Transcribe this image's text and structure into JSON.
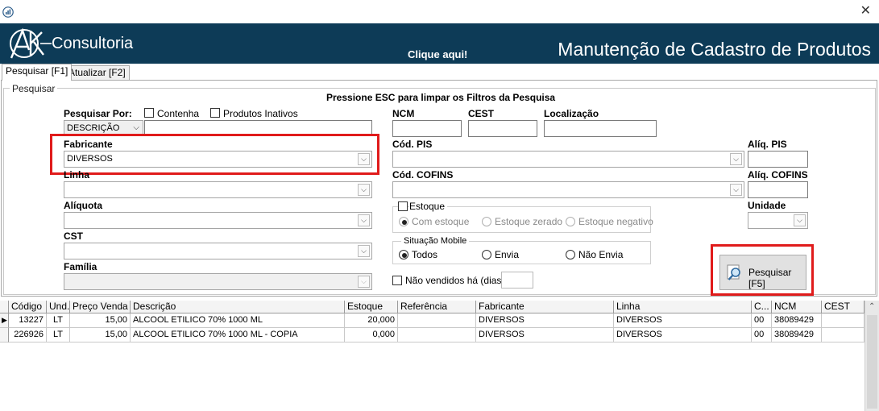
{
  "window": {
    "close_symbol": "✕"
  },
  "header": {
    "brand": "Consultoria",
    "logo_letters": "AK",
    "link": "Clique aqui!",
    "title": "Manutenção de Cadastro de Produtos",
    "bg_color": "#0d3b57"
  },
  "tabs": [
    {
      "label": "Pesquisar [F1]",
      "active": true
    },
    {
      "label": "Atualizar [F2]",
      "active": false
    }
  ],
  "group_label": "Pesquisar",
  "hint": "Pressione ESC para limpar os Filtros da Pesquisa",
  "search": {
    "label": "Pesquisar Por:",
    "contenha_label": "Contenha",
    "inativos_label": "Produtos Inativos",
    "mode_value": "DESCRIÇÃO",
    "text_value": ""
  },
  "fabricante": {
    "label": "Fabricante",
    "value": "DIVERSOS"
  },
  "linha": {
    "label": "Linha",
    "value": ""
  },
  "aliquota": {
    "label": "Alíquota",
    "value": ""
  },
  "cst": {
    "label": "CST",
    "value": ""
  },
  "familia": {
    "label": "Família",
    "value": ""
  },
  "ncm": {
    "label": "NCM",
    "value": ""
  },
  "cest": {
    "label": "CEST",
    "value": ""
  },
  "localizacao": {
    "label": "Localização",
    "value": ""
  },
  "cod_pis": {
    "label": "Cód. PIS",
    "value": ""
  },
  "aliq_pis": {
    "label": "Alíq. PIS",
    "value": ""
  },
  "cod_cofins": {
    "label": "Cód. COFINS",
    "value": ""
  },
  "aliq_cofins": {
    "label": "Alíq. COFINS",
    "value": ""
  },
  "unidade": {
    "label": "Unidade",
    "value": ""
  },
  "estoque": {
    "label": "Estoque",
    "options": [
      "Com estoque",
      "Estoque zerado",
      "Estoque negativo"
    ],
    "selected": "Com estoque"
  },
  "situacao": {
    "label": "Situação Mobile",
    "options": [
      "Todos",
      "Envia",
      "Não Envia"
    ],
    "selected": "Todos"
  },
  "nao_vendidos": {
    "label": "Não vendidos há (dias)",
    "value": ""
  },
  "search_button": {
    "label": "Pesquisar [F5]"
  },
  "grid": {
    "columns": [
      "Código",
      "Und.",
      "Preço Venda",
      "Descrição",
      "Estoque",
      "Referência",
      "Fabricante",
      "Linha",
      "C...",
      "NCM",
      "CEST"
    ],
    "rows": [
      [
        "13227",
        "LT",
        "15,00",
        "ALCOOL ETILICO  70%  1000 ML",
        "20,000",
        "",
        "DIVERSOS",
        "DIVERSOS",
        "00",
        "38089429",
        ""
      ],
      [
        "226926",
        "LT",
        "15,00",
        "ALCOOL ETILICO  70%  1000 ML - COPIA",
        "0,000",
        "",
        "DIVERSOS",
        "DIVERSOS",
        "00",
        "38089429",
        ""
      ]
    ]
  }
}
